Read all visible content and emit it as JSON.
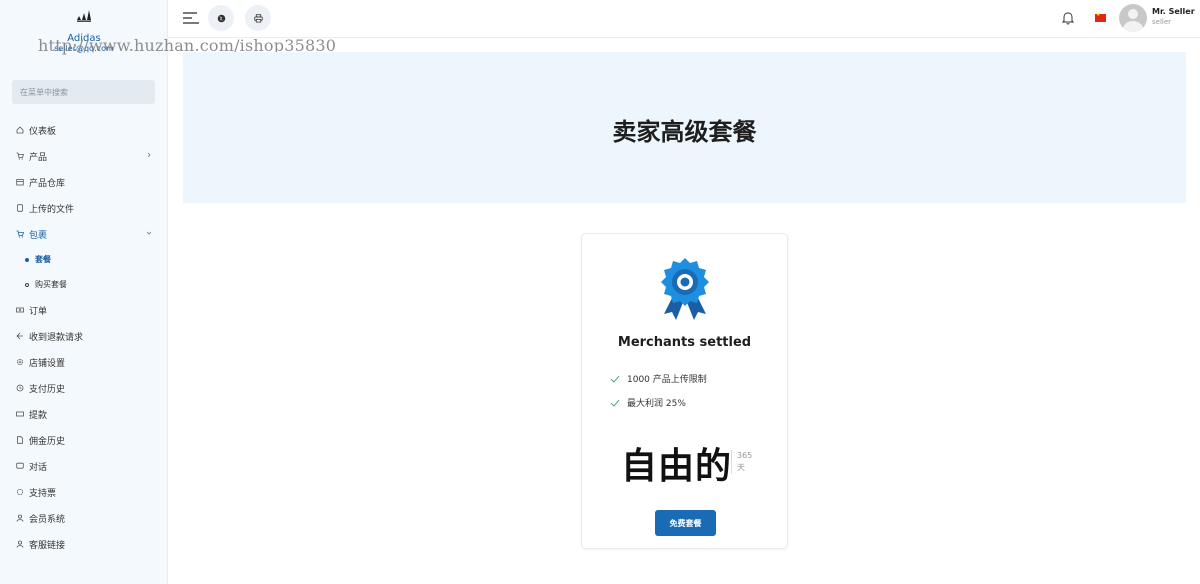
{
  "brand": {
    "name": "Adidas",
    "email": "seller@qq.com",
    "logo_icon": "adidas-logo-icon"
  },
  "watermark": "http://www.huzhan.com/ishop35830",
  "search": {
    "placeholder": "在菜单中搜索"
  },
  "menu": [
    {
      "label": "仪表板",
      "icon": "home-icon"
    },
    {
      "label": "产品",
      "icon": "cart-icon",
      "has_children": true
    },
    {
      "label": "产品仓库",
      "icon": "warehouse-icon"
    },
    {
      "label": "上传的文件",
      "icon": "file-icon"
    },
    {
      "label": "包裹",
      "icon": "package-icon",
      "expanded": true,
      "children": [
        {
          "label": "套餐",
          "current": true
        },
        {
          "label": "购买套餐",
          "current": false
        }
      ]
    },
    {
      "label": "订单",
      "icon": "money-icon"
    },
    {
      "label": "收到退款请求",
      "icon": "refund-icon"
    },
    {
      "label": "店铺设置",
      "icon": "settings-icon"
    },
    {
      "label": "支付历史",
      "icon": "history-icon"
    },
    {
      "label": "提款",
      "icon": "withdraw-icon"
    },
    {
      "label": "佣金历史",
      "icon": "document-icon"
    },
    {
      "label": "对话",
      "icon": "chat-icon"
    },
    {
      "label": "支持票",
      "icon": "support-icon"
    },
    {
      "label": "会员系统",
      "icon": "user-icon"
    },
    {
      "label": "客服链接",
      "icon": "user-icon"
    }
  ],
  "topbar": {
    "user_name": "Mr. Seller",
    "user_role": "seller",
    "flag": "china-flag-icon"
  },
  "hero": {
    "title": "卖家高级套餐"
  },
  "package": {
    "name": "Merchants settled",
    "features": [
      "1000 产品上传限制",
      "最大利润 25%"
    ],
    "price": "自由的",
    "duration_value": "365",
    "duration_unit": "天",
    "button_label": "免费套餐"
  },
  "colors": {
    "accent": "#1a6bb5",
    "hero_bg": "#eef6fd",
    "sidebar_bg": "#f4f9fd"
  }
}
